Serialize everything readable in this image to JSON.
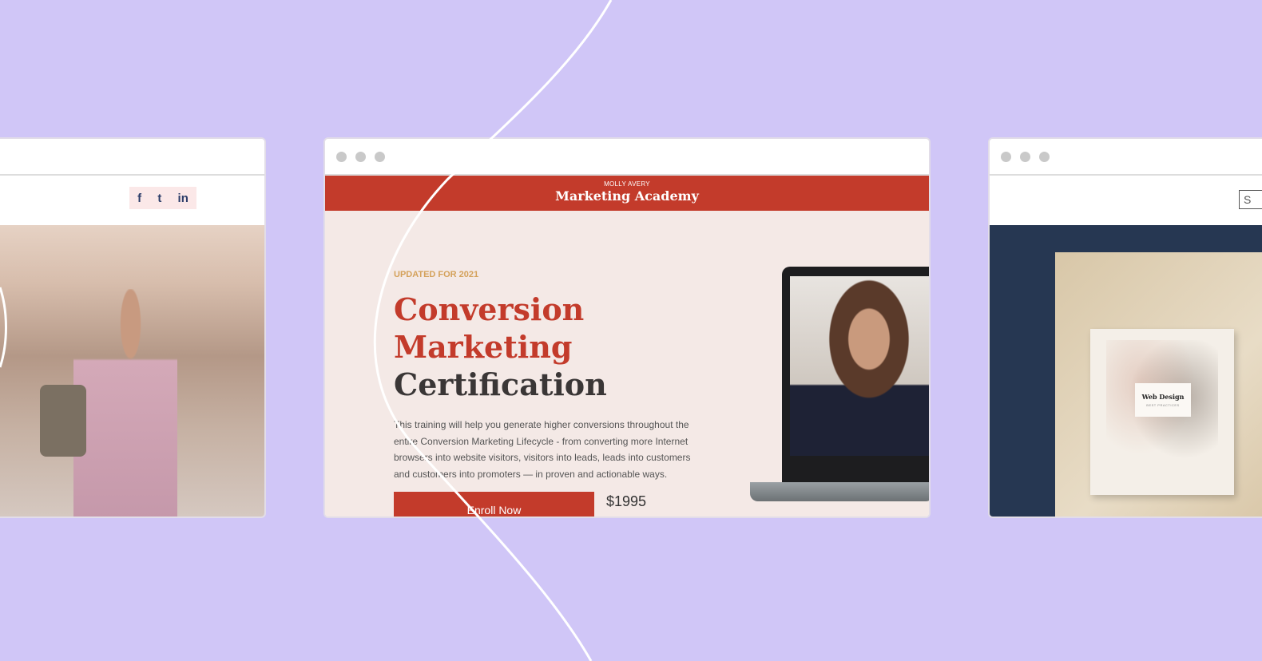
{
  "left_window": {
    "social_icons": [
      "facebook-icon",
      "twitter-icon",
      "linkedin-icon"
    ]
  },
  "center_window": {
    "header": {
      "subtitle": "MOLLY AVERY",
      "title": "Marketing Academy"
    },
    "hero": {
      "eyebrow": "UPDATED FOR 2021",
      "title_line1": "Conversion",
      "title_line2": "Marketing",
      "title_line3": "Certification",
      "description": "This training will help you generate higher conversions throughout the entire Conversion Marketing Lifecycle - from converting more Internet browsers into website visitors, visitors into leads, leads into customers and customers into promoters — in proven and actionable ways.",
      "cta_label": "Enroll Now",
      "price": "$1995"
    }
  },
  "right_window": {
    "search_label": "S",
    "book_title": "Web Design",
    "book_subtitle": "BEST PRACTICES"
  },
  "colors": {
    "background": "#d0c6f7",
    "accent_red": "#c33b2b",
    "eyebrow_gold": "#d4a15a",
    "navy": "#263752"
  }
}
